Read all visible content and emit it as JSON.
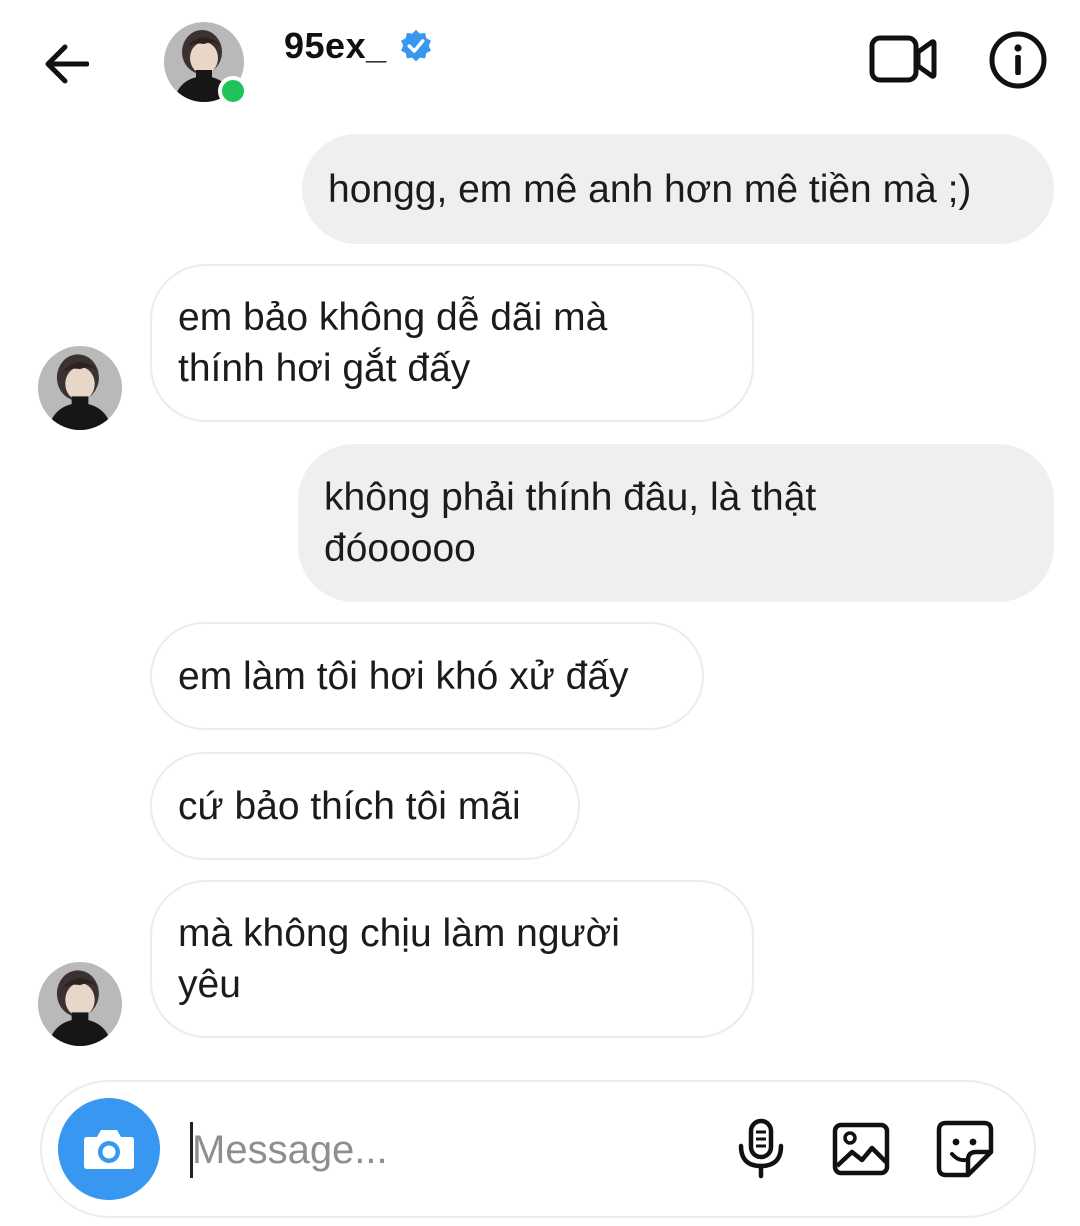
{
  "header": {
    "username": "95ex_",
    "verified": true,
    "online": true,
    "icons": {
      "back": "arrow-left-icon",
      "video": "video-camera-icon",
      "info": "info-icon"
    }
  },
  "messages": [
    {
      "side": "sent",
      "lines": [
        "hongg, em mê anh hơn mê tiền mà ;)"
      ]
    },
    {
      "side": "received",
      "lines": [
        "em bảo không dễ dãi mà",
        "thính hơi gắt đấy"
      ]
    },
    {
      "side": "sent",
      "lines": [
        "không phải thính đâu, là thật",
        "đóooooo"
      ]
    },
    {
      "side": "received",
      "lines": [
        "em làm tôi hơi khó xử đấy"
      ]
    },
    {
      "side": "received",
      "lines": [
        "cứ bảo thích tôi mãi"
      ]
    },
    {
      "side": "received",
      "lines": [
        "mà không chịu làm người",
        "yêu"
      ]
    }
  ],
  "composer": {
    "placeholder": "Message...",
    "value": "",
    "icons": {
      "camera": "camera-icon",
      "mic": "microphone-icon",
      "gallery": "image-icon",
      "sticker": "sticker-icon"
    }
  },
  "colors": {
    "accent": "#3897f0",
    "online": "#1ec45a",
    "sent_bubble": "#efefef",
    "received_border": "#ececec"
  }
}
